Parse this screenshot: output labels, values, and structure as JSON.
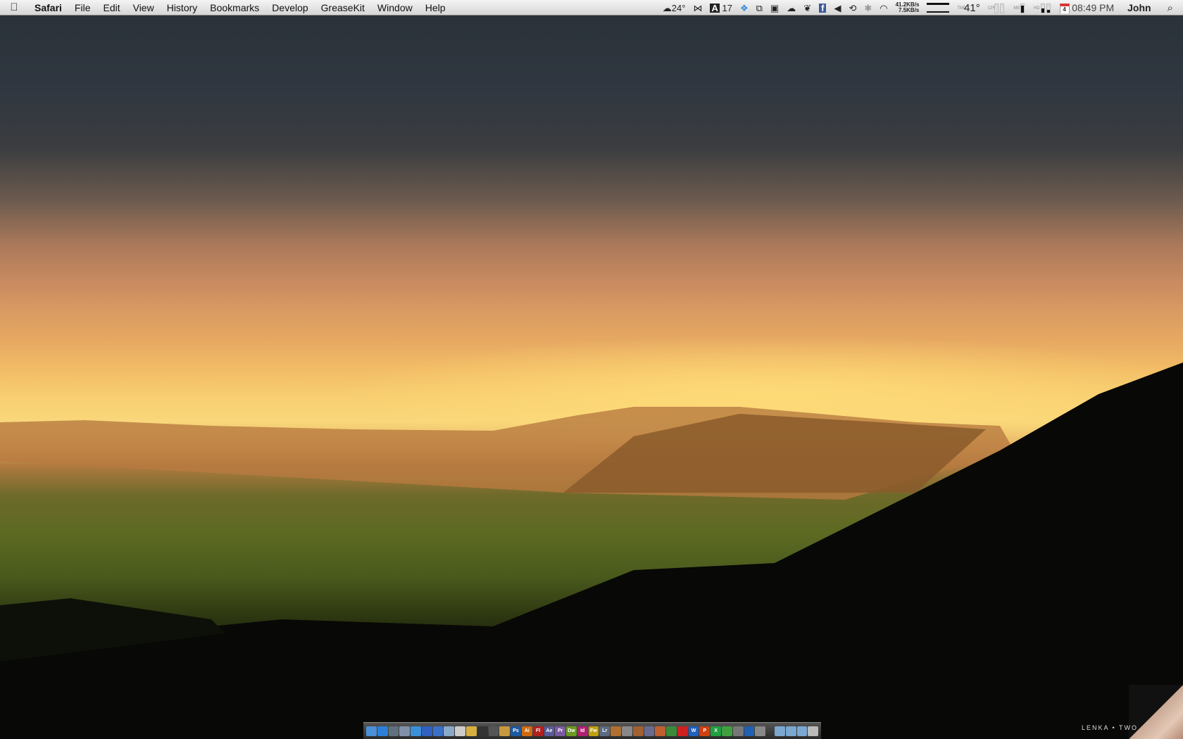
{
  "menubar": {
    "apple": "",
    "app": "Safari",
    "menus": [
      "File",
      "Edit",
      "View",
      "History",
      "Bookmarks",
      "Develop",
      "GreaseKit",
      "Window",
      "Help"
    ]
  },
  "status": {
    "weather": "24°",
    "weather_icon": "cloud-sun-icon",
    "adobe_count": "17",
    "icons": [
      "growl-icon",
      "adobe-updater-icon",
      "dropbox-icon",
      "screen-sharing-icon",
      "airplay-icon",
      "icloud-icon",
      "evernote-icon",
      "facebook-icon",
      "volume-icon",
      "time-machine-icon",
      "bluetooth-icon",
      "wifi-icon"
    ],
    "net_up": "41.2KB/s",
    "net_down": "7.5KB/s",
    "tmp_label": "TMP",
    "temp": "41°",
    "cpu_label": "CPU",
    "cpu_levels": [
      0,
      0
    ],
    "mem_label": "MEM",
    "mem_level": 0.85,
    "hd_label": "HD",
    "hd_levels": [
      0.45,
      0.35
    ],
    "calendar_day": "4",
    "time": "08:49 PM",
    "user": "John",
    "spotlight_icon": "search-icon"
  },
  "dock": {
    "items": [
      {
        "name": "finder",
        "label": "",
        "color": "#4a8fd8"
      },
      {
        "name": "app-store",
        "label": "",
        "color": "#2c7fd6"
      },
      {
        "name": "dashboard",
        "label": "",
        "color": "#607080"
      },
      {
        "name": "preview",
        "label": "",
        "color": "#8090a8"
      },
      {
        "name": "safari",
        "label": "",
        "color": "#3a90d8"
      },
      {
        "name": "itunes",
        "label": "",
        "color": "#3060c0"
      },
      {
        "name": "xcode",
        "label": "",
        "color": "#3a70c8"
      },
      {
        "name": "mail",
        "label": "",
        "color": "#8aa8c8"
      },
      {
        "name": "camera",
        "label": "",
        "color": "#cccccc"
      },
      {
        "name": "stickies",
        "label": "",
        "color": "#d8b040"
      },
      {
        "name": "aperture",
        "label": "",
        "color": "#333"
      },
      {
        "name": "final-cut",
        "label": "",
        "color": "#555"
      },
      {
        "name": "iphoto",
        "label": "",
        "color": "#c89840"
      },
      {
        "name": "photoshop",
        "label": "Ps",
        "color": "#1c5aa0"
      },
      {
        "name": "illustrator",
        "label": "Ai",
        "color": "#d06a10"
      },
      {
        "name": "flash",
        "label": "Fl",
        "color": "#b02020"
      },
      {
        "name": "after-effects",
        "label": "Ae",
        "color": "#5a5a9a"
      },
      {
        "name": "premiere",
        "label": "Pr",
        "color": "#7a5aa0"
      },
      {
        "name": "dreamweaver",
        "label": "Dw",
        "color": "#6a9a20"
      },
      {
        "name": "indesign",
        "label": "Id",
        "color": "#b02070"
      },
      {
        "name": "fireworks",
        "label": "Fw",
        "color": "#c0a010"
      },
      {
        "name": "lightroom",
        "label": "Lr",
        "color": "#5a6a80"
      },
      {
        "name": "image-capture",
        "label": "",
        "color": "#b07030"
      },
      {
        "name": "imovie",
        "label": "",
        "color": "#888"
      },
      {
        "name": "garageband",
        "label": "",
        "color": "#a06030"
      },
      {
        "name": "logic",
        "label": "",
        "color": "#6a6a90"
      },
      {
        "name": "keynote",
        "label": "",
        "color": "#c06030"
      },
      {
        "name": "numbers",
        "label": "",
        "color": "#3a8a3a"
      },
      {
        "name": "flashcards",
        "label": "",
        "color": "#d02020"
      },
      {
        "name": "word",
        "label": "W",
        "color": "#2060c0"
      },
      {
        "name": "powerpoint",
        "label": "P",
        "color": "#d04010"
      },
      {
        "name": "excel",
        "label": "X",
        "color": "#20a040"
      },
      {
        "name": "transmission",
        "label": "",
        "color": "#40a040"
      },
      {
        "name": "automator",
        "label": "",
        "color": "#777"
      },
      {
        "name": "parallels",
        "label": "",
        "color": "#2060b0"
      },
      {
        "name": "system-preferences",
        "label": "",
        "color": "#888"
      },
      {
        "name": "applications-folder",
        "label": "",
        "color": "#7aa8d0"
      },
      {
        "name": "documents-folder",
        "label": "",
        "color": "#7aa8d0"
      },
      {
        "name": "downloads-folder",
        "label": "",
        "color": "#7aa8d0"
      },
      {
        "name": "trash",
        "label": "",
        "color": "#bbb"
      }
    ]
  },
  "now_playing": {
    "album": "LENKA • TWO"
  }
}
